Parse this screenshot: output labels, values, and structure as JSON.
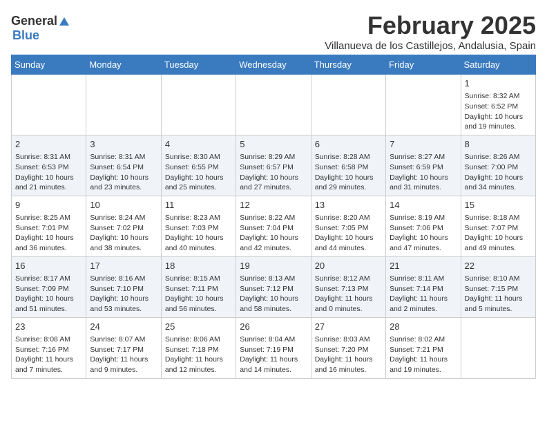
{
  "header": {
    "logo_general": "General",
    "logo_blue": "Blue",
    "month_title": "February 2025",
    "subtitle": "Villanueva de los Castillejos, Andalusia, Spain"
  },
  "days_of_week": [
    "Sunday",
    "Monday",
    "Tuesday",
    "Wednesday",
    "Thursday",
    "Friday",
    "Saturday"
  ],
  "weeks": [
    {
      "row_class": "normal-row",
      "days": [
        {
          "num": "",
          "empty": true
        },
        {
          "num": "",
          "empty": true
        },
        {
          "num": "",
          "empty": true
        },
        {
          "num": "",
          "empty": true
        },
        {
          "num": "",
          "empty": true
        },
        {
          "num": "",
          "empty": true
        },
        {
          "num": "1",
          "sunrise": "Sunrise: 8:32 AM",
          "sunset": "Sunset: 6:52 PM",
          "daylight": "Daylight: 10 hours and 19 minutes."
        }
      ]
    },
    {
      "row_class": "alt-row",
      "days": [
        {
          "num": "2",
          "sunrise": "Sunrise: 8:31 AM",
          "sunset": "Sunset: 6:53 PM",
          "daylight": "Daylight: 10 hours and 21 minutes."
        },
        {
          "num": "3",
          "sunrise": "Sunrise: 8:31 AM",
          "sunset": "Sunset: 6:54 PM",
          "daylight": "Daylight: 10 hours and 23 minutes."
        },
        {
          "num": "4",
          "sunrise": "Sunrise: 8:30 AM",
          "sunset": "Sunset: 6:55 PM",
          "daylight": "Daylight: 10 hours and 25 minutes."
        },
        {
          "num": "5",
          "sunrise": "Sunrise: 8:29 AM",
          "sunset": "Sunset: 6:57 PM",
          "daylight": "Daylight: 10 hours and 27 minutes."
        },
        {
          "num": "6",
          "sunrise": "Sunrise: 8:28 AM",
          "sunset": "Sunset: 6:58 PM",
          "daylight": "Daylight: 10 hours and 29 minutes."
        },
        {
          "num": "7",
          "sunrise": "Sunrise: 8:27 AM",
          "sunset": "Sunset: 6:59 PM",
          "daylight": "Daylight: 10 hours and 31 minutes."
        },
        {
          "num": "8",
          "sunrise": "Sunrise: 8:26 AM",
          "sunset": "Sunset: 7:00 PM",
          "daylight": "Daylight: 10 hours and 34 minutes."
        }
      ]
    },
    {
      "row_class": "normal-row",
      "days": [
        {
          "num": "9",
          "sunrise": "Sunrise: 8:25 AM",
          "sunset": "Sunset: 7:01 PM",
          "daylight": "Daylight: 10 hours and 36 minutes."
        },
        {
          "num": "10",
          "sunrise": "Sunrise: 8:24 AM",
          "sunset": "Sunset: 7:02 PM",
          "daylight": "Daylight: 10 hours and 38 minutes."
        },
        {
          "num": "11",
          "sunrise": "Sunrise: 8:23 AM",
          "sunset": "Sunset: 7:03 PM",
          "daylight": "Daylight: 10 hours and 40 minutes."
        },
        {
          "num": "12",
          "sunrise": "Sunrise: 8:22 AM",
          "sunset": "Sunset: 7:04 PM",
          "daylight": "Daylight: 10 hours and 42 minutes."
        },
        {
          "num": "13",
          "sunrise": "Sunrise: 8:20 AM",
          "sunset": "Sunset: 7:05 PM",
          "daylight": "Daylight: 10 hours and 44 minutes."
        },
        {
          "num": "14",
          "sunrise": "Sunrise: 8:19 AM",
          "sunset": "Sunset: 7:06 PM",
          "daylight": "Daylight: 10 hours and 47 minutes."
        },
        {
          "num": "15",
          "sunrise": "Sunrise: 8:18 AM",
          "sunset": "Sunset: 7:07 PM",
          "daylight": "Daylight: 10 hours and 49 minutes."
        }
      ]
    },
    {
      "row_class": "alt-row",
      "days": [
        {
          "num": "16",
          "sunrise": "Sunrise: 8:17 AM",
          "sunset": "Sunset: 7:09 PM",
          "daylight": "Daylight: 10 hours and 51 minutes."
        },
        {
          "num": "17",
          "sunrise": "Sunrise: 8:16 AM",
          "sunset": "Sunset: 7:10 PM",
          "daylight": "Daylight: 10 hours and 53 minutes."
        },
        {
          "num": "18",
          "sunrise": "Sunrise: 8:15 AM",
          "sunset": "Sunset: 7:11 PM",
          "daylight": "Daylight: 10 hours and 56 minutes."
        },
        {
          "num": "19",
          "sunrise": "Sunrise: 8:13 AM",
          "sunset": "Sunset: 7:12 PM",
          "daylight": "Daylight: 10 hours and 58 minutes."
        },
        {
          "num": "20",
          "sunrise": "Sunrise: 8:12 AM",
          "sunset": "Sunset: 7:13 PM",
          "daylight": "Daylight: 11 hours and 0 minutes."
        },
        {
          "num": "21",
          "sunrise": "Sunrise: 8:11 AM",
          "sunset": "Sunset: 7:14 PM",
          "daylight": "Daylight: 11 hours and 2 minutes."
        },
        {
          "num": "22",
          "sunrise": "Sunrise: 8:10 AM",
          "sunset": "Sunset: 7:15 PM",
          "daylight": "Daylight: 11 hours and 5 minutes."
        }
      ]
    },
    {
      "row_class": "normal-row",
      "days": [
        {
          "num": "23",
          "sunrise": "Sunrise: 8:08 AM",
          "sunset": "Sunset: 7:16 PM",
          "daylight": "Daylight: 11 hours and 7 minutes."
        },
        {
          "num": "24",
          "sunrise": "Sunrise: 8:07 AM",
          "sunset": "Sunset: 7:17 PM",
          "daylight": "Daylight: 11 hours and 9 minutes."
        },
        {
          "num": "25",
          "sunrise": "Sunrise: 8:06 AM",
          "sunset": "Sunset: 7:18 PM",
          "daylight": "Daylight: 11 hours and 12 minutes."
        },
        {
          "num": "26",
          "sunrise": "Sunrise: 8:04 AM",
          "sunset": "Sunset: 7:19 PM",
          "daylight": "Daylight: 11 hours and 14 minutes."
        },
        {
          "num": "27",
          "sunrise": "Sunrise: 8:03 AM",
          "sunset": "Sunset: 7:20 PM",
          "daylight": "Daylight: 11 hours and 16 minutes."
        },
        {
          "num": "28",
          "sunrise": "Sunrise: 8:02 AM",
          "sunset": "Sunset: 7:21 PM",
          "daylight": "Daylight: 11 hours and 19 minutes."
        },
        {
          "num": "",
          "empty": true
        }
      ]
    }
  ]
}
